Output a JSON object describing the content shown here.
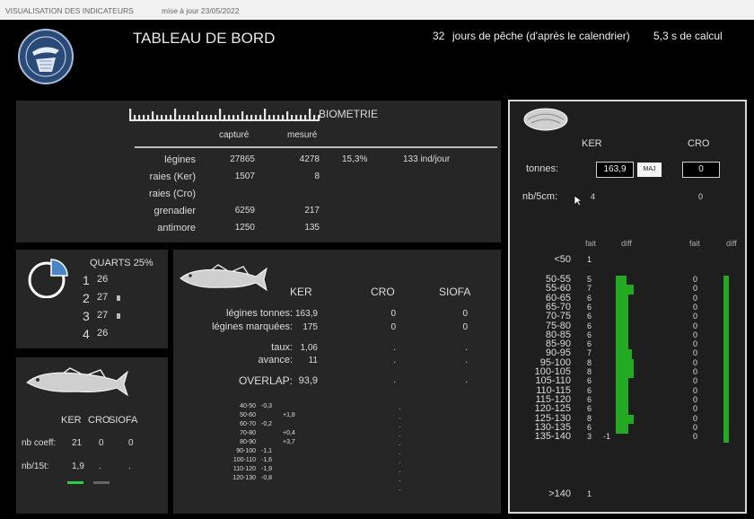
{
  "window": {
    "app_title": "VISUALISATION DES INDICATEURS",
    "update_label": "mise à jour 23/05/2022"
  },
  "header": {
    "title": "TABLEAU DE BORD",
    "days_value": "32",
    "days_label": "jours de pêche (d'après le calendrier)",
    "calc_time": "5,3 s de calcul"
  },
  "biometrie": {
    "title": "BIOMETRIE",
    "col_captured": "capturé",
    "col_measured": "mesuré",
    "rows": [
      {
        "label": "légines",
        "captured": "27865",
        "measured": "4278",
        "pct": "15,3%",
        "rate": "133 ind/jour"
      },
      {
        "label": "raies (Ker)",
        "captured": "1507",
        "measured": "8",
        "pct": "",
        "rate": ""
      },
      {
        "label": "raies (Cro)",
        "captured": "",
        "measured": "",
        "pct": "",
        "rate": ""
      },
      {
        "label": "grenadier",
        "captured": "6259",
        "measured": "217",
        "pct": "",
        "rate": ""
      },
      {
        "label": "antimore",
        "captured": "1250",
        "measured": "135",
        "pct": "",
        "rate": ""
      }
    ]
  },
  "quarts": {
    "title": "QUARTS 25%",
    "rows": [
      {
        "num": "1",
        "value": "26",
        "flag": false
      },
      {
        "num": "2",
        "value": "27",
        "flag": true
      },
      {
        "num": "3",
        "value": "27",
        "flag": true
      },
      {
        "num": "4",
        "value": "26",
        "flag": false
      }
    ]
  },
  "coeff": {
    "headers": [
      "KER",
      "CRO",
      "SIOFA"
    ],
    "rows": [
      {
        "label": "nb coeff:",
        "values": [
          "21",
          "0",
          "0"
        ]
      },
      {
        "label": "nb/15t:",
        "values": [
          "1,9",
          ".",
          "."
        ]
      }
    ],
    "legend_colors": [
      "#2ecc40",
      "#666666"
    ]
  },
  "overlap": {
    "headers": [
      "KER",
      "CRO",
      "SIOFA"
    ],
    "rows": [
      {
        "label": "légines tonnes:",
        "values": [
          "163,9",
          "0",
          "0"
        ]
      },
      {
        "label": "légines marquées:",
        "values": [
          "175",
          "0",
          "0"
        ]
      },
      {
        "label": "taux:",
        "values": [
          "1,06",
          ".",
          "."
        ]
      },
      {
        "label": "avance:",
        "values": [
          "11",
          ".",
          "."
        ]
      },
      {
        "label": "OVERLAP:",
        "values": [
          "93,9",
          ".",
          "."
        ]
      }
    ],
    "bins": [
      {
        "range": "40-50",
        "neg": "-0,3",
        "pos": ""
      },
      {
        "range": "50-60",
        "neg": "",
        "pos": "+1,8"
      },
      {
        "range": "60-70",
        "neg": "-0,2",
        "pos": ""
      },
      {
        "range": "70-80",
        "neg": "",
        "pos": "+0,4"
      },
      {
        "range": "80-90",
        "neg": "",
        "pos": "+3,7"
      },
      {
        "range": "90-100",
        "neg": "-1,1",
        "pos": ""
      },
      {
        "range": "100-110",
        "neg": "-1,6",
        "pos": ""
      },
      {
        "range": "110-120",
        "neg": "-1,9",
        "pos": ""
      },
      {
        "range": "120-130",
        "neg": "-0,8",
        "pos": ""
      }
    ],
    "dots_count": 10
  },
  "maj": {
    "ker_label": "KER",
    "cro_label": "CRO",
    "tonnes_label": "tonnes:",
    "ker_tonnes": "163,9",
    "maj_button": "MAJ",
    "cro_tonnes": "0",
    "nb5_label": "nb/5cm:",
    "ker_nb5": "4",
    "cro_nb5": "0",
    "col_fait": "fait",
    "col_diff": "diff",
    "bar_color": "#22aa22",
    "under_label": "<50",
    "under_ker": "1",
    "over_label": ">140",
    "over_ker": "1",
    "classes": [
      {
        "label": "50-55",
        "ker_fait": "5",
        "ker_diff": "",
        "ker_bar": 0.5,
        "cro_fait": "0",
        "cro_bar": 0.4
      },
      {
        "label": "55-60",
        "ker_fait": "7",
        "ker_diff": "",
        "ker_bar": 1.0,
        "cro_fait": "0",
        "cro_bar": 0.4
      },
      {
        "label": "60-65",
        "ker_fait": "6",
        "ker_diff": "",
        "ker_bar": 0.6,
        "cro_fait": "0",
        "cro_bar": 0.4
      },
      {
        "label": "65-70",
        "ker_fait": "6",
        "ker_diff": "",
        "ker_bar": 0.6,
        "cro_fait": "0",
        "cro_bar": 0.4
      },
      {
        "label": "70-75",
        "ker_fait": "6",
        "ker_diff": "",
        "ker_bar": 0.6,
        "cro_fait": "0",
        "cro_bar": 0.4
      },
      {
        "label": "75-80",
        "ker_fait": "6",
        "ker_diff": "",
        "ker_bar": 0.6,
        "cro_fait": "0",
        "cro_bar": 0.4
      },
      {
        "label": "80-85",
        "ker_fait": "6",
        "ker_diff": "",
        "ker_bar": 0.6,
        "cro_fait": "0",
        "cro_bar": 0.4
      },
      {
        "label": "85-90",
        "ker_fait": "6",
        "ker_diff": "",
        "ker_bar": 0.6,
        "cro_fait": "0",
        "cro_bar": 0.4
      },
      {
        "label": "90-95",
        "ker_fait": "7",
        "ker_diff": "",
        "ker_bar": 0.9,
        "cro_fait": "0",
        "cro_bar": 0.4
      },
      {
        "label": "95-100",
        "ker_fait": "8",
        "ker_diff": "",
        "ker_bar": 1.0,
        "cro_fait": "0",
        "cro_bar": 0.4
      },
      {
        "label": "100-105",
        "ker_fait": "8",
        "ker_diff": "",
        "ker_bar": 1.0,
        "cro_fait": "0",
        "cro_bar": 0.4
      },
      {
        "label": "105-110",
        "ker_fait": "6",
        "ker_diff": "",
        "ker_bar": 0.6,
        "cro_fait": "0",
        "cro_bar": 0.4
      },
      {
        "label": "110-115",
        "ker_fait": "6",
        "ker_diff": "",
        "ker_bar": 0.6,
        "cro_fait": "0",
        "cro_bar": 0.4
      },
      {
        "label": "115-120",
        "ker_fait": "6",
        "ker_diff": "",
        "ker_bar": 0.6,
        "cro_fait": "0",
        "cro_bar": 0.4
      },
      {
        "label": "120-125",
        "ker_fait": "6",
        "ker_diff": "",
        "ker_bar": 0.6,
        "cro_fait": "0",
        "cro_bar": 0.4
      },
      {
        "label": "125-130",
        "ker_fait": "8",
        "ker_diff": "",
        "ker_bar": 1.0,
        "cro_fait": "0",
        "cro_bar": 0.4
      },
      {
        "label": "130-135",
        "ker_fait": "6",
        "ker_diff": "",
        "ker_bar": 0.6,
        "cro_fait": "0",
        "cro_bar": 0.4
      },
      {
        "label": "135-140",
        "ker_fait": "3",
        "ker_diff": "-1",
        "ker_bar": 0.0,
        "cro_fait": "0",
        "cro_bar": 0.4
      }
    ]
  }
}
